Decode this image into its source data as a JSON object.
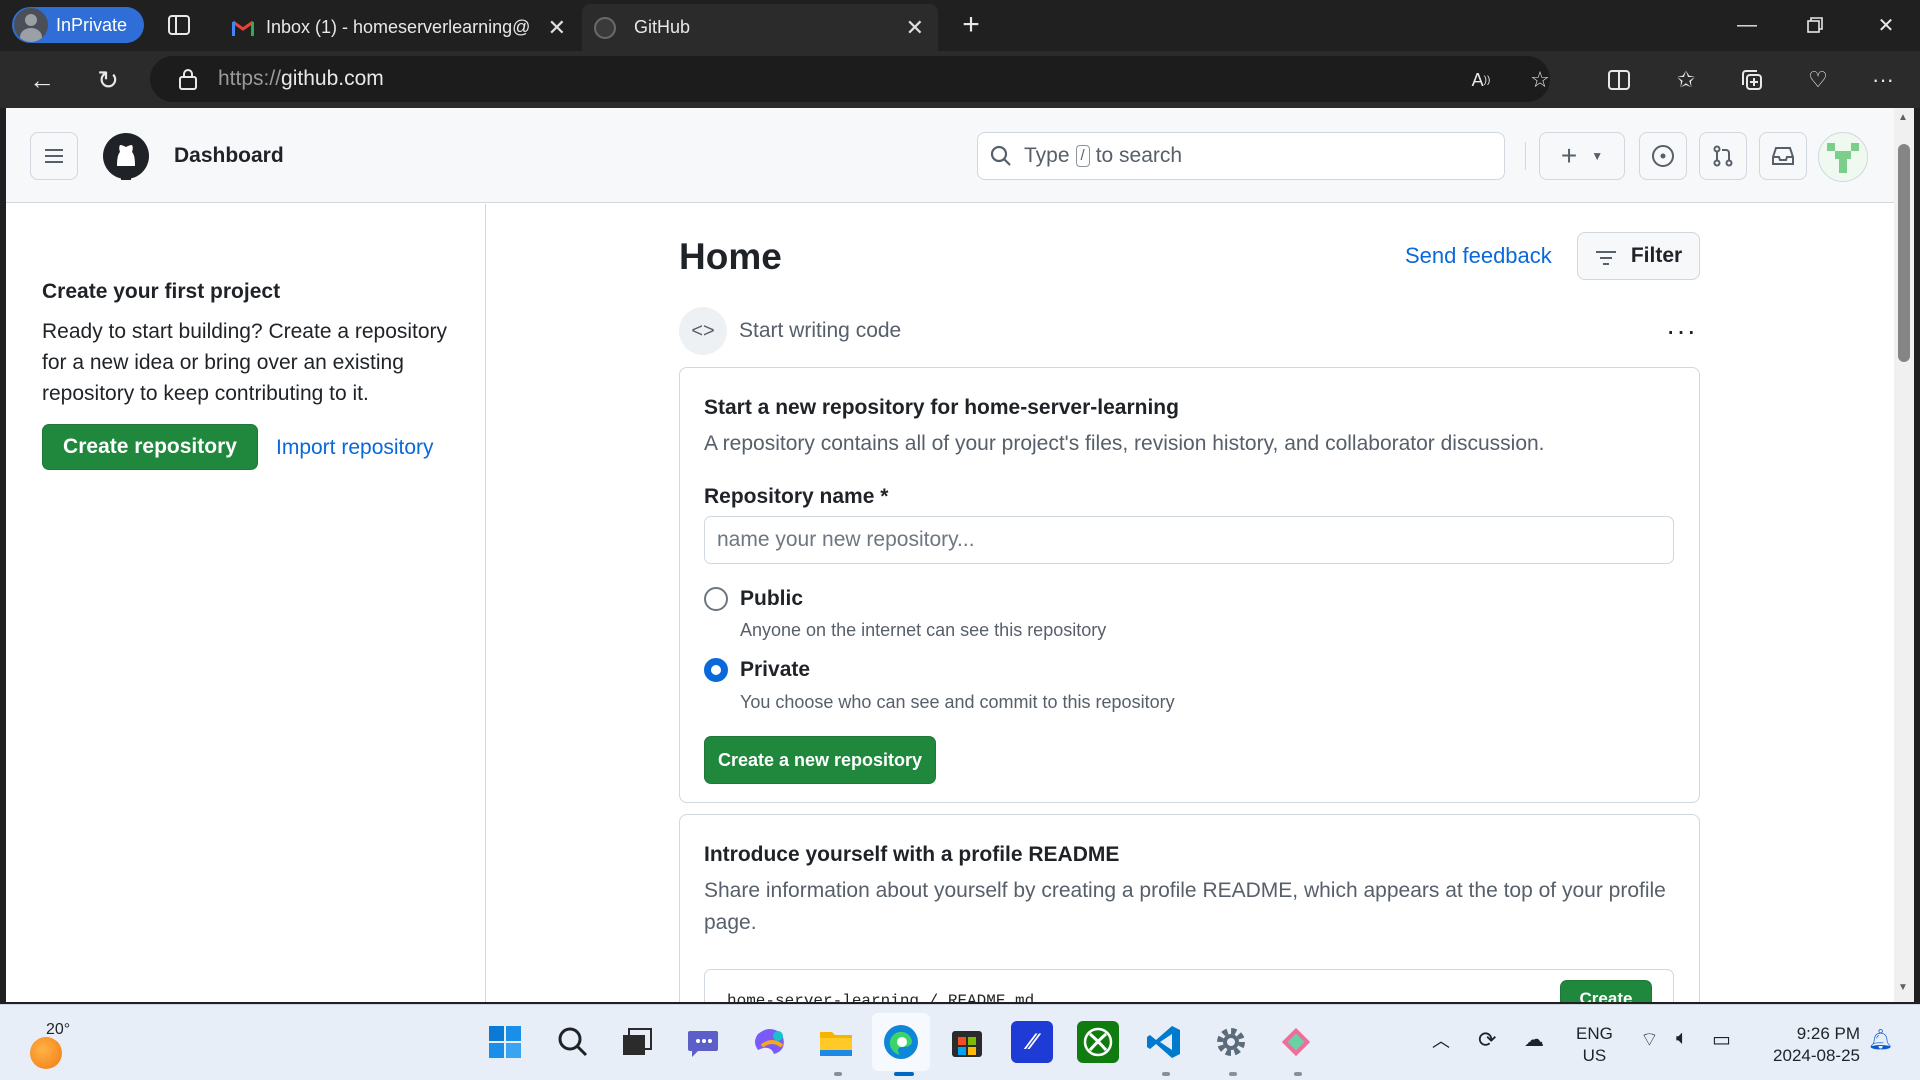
{
  "browser": {
    "inprivate_label": "InPrivate",
    "tabs": [
      {
        "title": "Inbox (1) - homeserverlearning@"
      },
      {
        "title": "GitHub"
      }
    ],
    "url_prefix": "https://",
    "url_host": "github.com"
  },
  "header": {
    "title": "Dashboard",
    "search_before": "Type",
    "search_key": "/",
    "search_after": "to search",
    "plus": "+"
  },
  "sidebar": {
    "title": "Create your first project",
    "text": "Ready to start building? Create a repository for a new idea or bring over an existing repository to keep contributing to it.",
    "create_label": "Create repository",
    "import_label": "Import repository"
  },
  "main": {
    "title": "Home",
    "feedback_label": "Send feedback",
    "filter_label": "Filter",
    "section_label": "Start writing code",
    "more_label": "···"
  },
  "new_repo_card": {
    "title": "Start a new repository for home-server-learning",
    "description": "A repository contains all of your project's files, revision history, and collaborator discussion.",
    "name_label": "Repository name *",
    "name_placeholder": "name your new repository...",
    "public_label": "Public",
    "public_desc": "Anyone on the internet can see this repository",
    "private_label": "Private",
    "private_desc": "You choose who can see and commit to this repository",
    "visibility_selected": "Private",
    "submit_label": "Create a new repository"
  },
  "readme_card": {
    "title": "Introduce yourself with a profile README",
    "description": "Share information about yourself by creating a profile README, which appears at the top of your profile page.",
    "path": "home-server-learning / README.md",
    "button_label": "Create"
  },
  "taskbar": {
    "weather_temp": "20°",
    "lang_line1": "ENG",
    "lang_line2": "US",
    "time": "9:26 PM",
    "date": "2024-08-25"
  },
  "colors": {
    "accent_blue": "#0969da",
    "primary_green": "#1f883d",
    "inprivate_blue": "#2e6ed6"
  }
}
